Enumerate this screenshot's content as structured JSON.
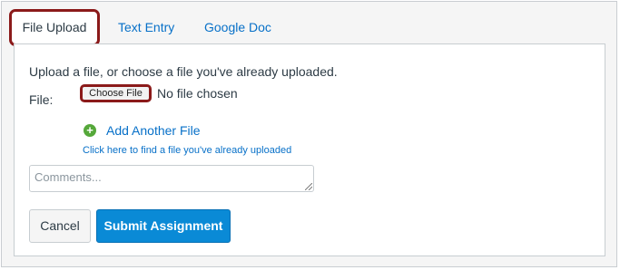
{
  "tabs": [
    {
      "label": "File Upload",
      "active": true
    },
    {
      "label": "Text Entry",
      "active": false
    },
    {
      "label": "Google Doc",
      "active": false
    }
  ],
  "upload": {
    "instructions": "Upload a file, or choose a file you've already uploaded.",
    "file_label": "File:",
    "choose_file_label": "Choose File",
    "no_file_text": "No file chosen",
    "add_another_label": "Add Another File",
    "add_icon": "plus-circle-icon",
    "find_uploaded_link": "Click here to find a file you've already uploaded"
  },
  "comments": {
    "placeholder": "Comments...",
    "value": ""
  },
  "actions": {
    "cancel_label": "Cancel",
    "submit_label": "Submit Assignment"
  },
  "colors": {
    "link": "#0770c8",
    "primary_button": "#0a8ad6",
    "add_icon": "#55a83a",
    "highlight_outline": "#8b1a1a"
  }
}
